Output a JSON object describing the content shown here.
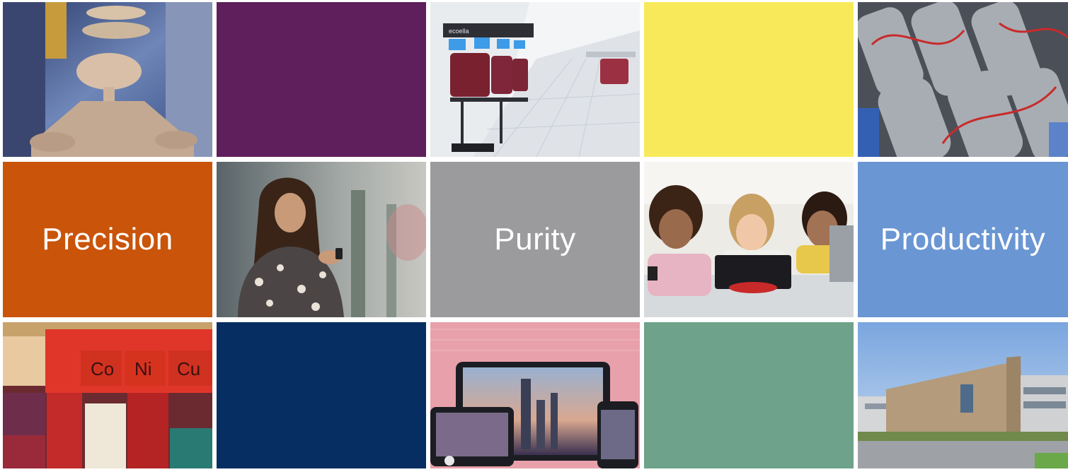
{
  "tiles": {
    "precision": {
      "label": "Precision",
      "color": "#c9540a"
    },
    "purity": {
      "label": "Purity",
      "color": "#9b9b9d"
    },
    "productivity": {
      "label": "Productivity",
      "color": "#6a96d3"
    },
    "purple": {
      "color": "#5e1f5c"
    },
    "yellow": {
      "color": "#f7e95a"
    },
    "navy": {
      "color": "#062e63"
    },
    "green": {
      "color": "#6ea28a"
    }
  },
  "photos": {
    "cleanroom_equipment": {
      "brand_text": "ecoella"
    },
    "periodic_table": {
      "elements": [
        "Co",
        "Ni",
        "Cu"
      ]
    }
  }
}
